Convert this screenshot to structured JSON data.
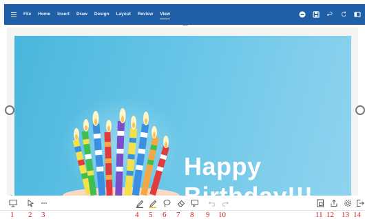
{
  "ribbon": {
    "tabs": [
      {
        "label": "File"
      },
      {
        "label": "Home"
      },
      {
        "label": "Insert"
      },
      {
        "label": "Draw"
      },
      {
        "label": "Design"
      },
      {
        "label": "Layout"
      },
      {
        "label": "Review"
      },
      {
        "label": "View"
      }
    ],
    "active_tab": "View",
    "right_icons": [
      "present-icon",
      "save-icon",
      "undo-icon",
      "redo-icon",
      "panel-toggle-icon"
    ]
  },
  "slide": {
    "line1": "Happy",
    "line2": "Birthday!!!"
  },
  "toolbar": {
    "icons": [
      "slide-panel-icon",
      "pointer-icon",
      "more-icon",
      "pen-icon",
      "highlighter-icon",
      "lasso-icon",
      "eraser-icon",
      "ink-to-shape-icon",
      "undo-icon",
      "redo-icon",
      "slide-sorter-icon",
      "share-icon",
      "settings-icon",
      "exit-icon"
    ]
  },
  "annotations": [
    "1",
    "2",
    "3",
    "4",
    "5",
    "6",
    "7",
    "8",
    "9",
    "10",
    "11",
    "12",
    "13",
    "14"
  ],
  "colors": {
    "ribbon": "#1f5fa6",
    "slide_bg": "#63c3e6",
    "annotation": "#cc1f1f",
    "highlighter_accent": "#f2c200"
  }
}
